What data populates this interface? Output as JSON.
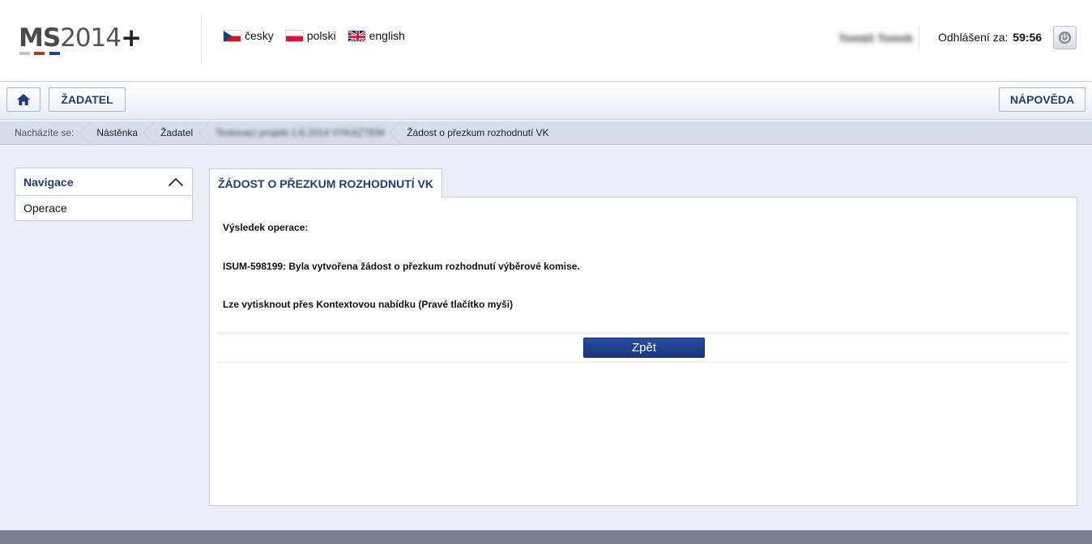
{
  "header": {
    "logo": {
      "ms": "MS",
      "year": "2014",
      "plus": "+"
    },
    "languages": [
      {
        "label": "česky",
        "icon": "czech-flag-icon"
      },
      {
        "label": "polski",
        "icon": "polish-flag-icon"
      },
      {
        "label": "english",
        "icon": "uk-flag-icon"
      }
    ],
    "user_name": "Tomáš Tomek",
    "logout_label": "Odhlášení za:",
    "logout_timer": "59:56",
    "power_icon": "power-icon"
  },
  "toolbar": {
    "home_icon": "home-icon",
    "zadatel_label": "ŽADATEL",
    "napoveda_label": "NÁPOVĚDA"
  },
  "breadcrumb": {
    "prefix": "Nacházíte se:",
    "items": [
      "Nástěnka",
      "Žadatel",
      "Testovací projekt 1.6.2014 VYKAZTEM",
      "Žádost o přezkum rozhodnutí VK"
    ]
  },
  "navigation": {
    "title": "Navigace",
    "items": [
      "Operace"
    ]
  },
  "main": {
    "tab_label": "ŽÁDOST O PŘEZKUM ROZHODNUTÍ VK",
    "result_label": "Výsledek operace:",
    "result_message": "ISUM-598199: Byla vytvořena žádost o přezkum rozhodnutí výběrové komise.",
    "print_hint": "Lze vytisknout přes Kontextovou nabídku (Pravé tlačítko myši)",
    "back_button": "Zpět"
  },
  "colors": {
    "accent": "#1f3d7a",
    "button_blue": "#1f3f8c",
    "background": "#ebeef7"
  }
}
